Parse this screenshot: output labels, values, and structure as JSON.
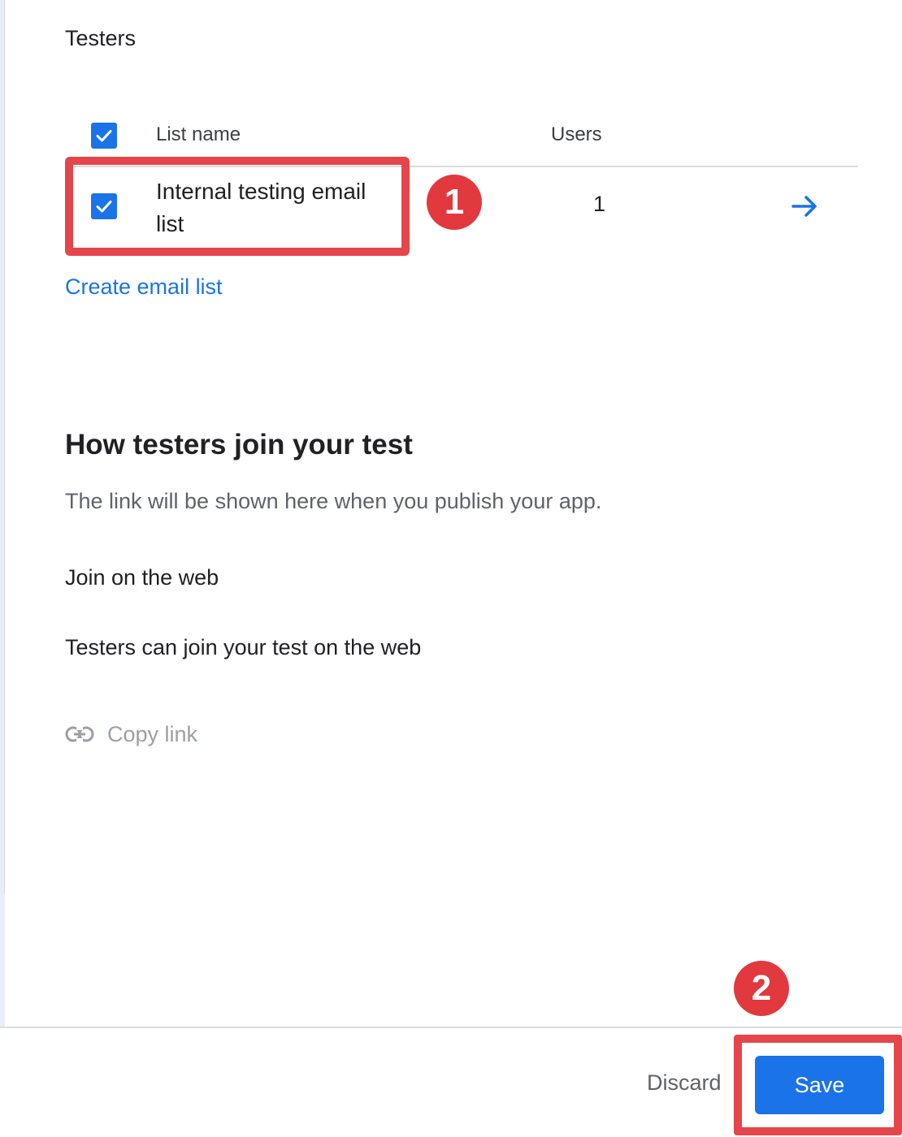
{
  "section": {
    "title": "Testers"
  },
  "table": {
    "header": {
      "list_name": "List name",
      "users": "Users",
      "select_all_checked": true
    },
    "rows": [
      {
        "name": "Internal testing email list",
        "users": "1",
        "checked": true,
        "action_icon": "arrow-right-icon"
      }
    ]
  },
  "create_link": "Create email list",
  "join": {
    "heading": "How testers join your test",
    "description": "The link will be shown here when you publish your app.",
    "web_label": "Join on the web",
    "web_description": "Testers can join your test on the web",
    "copy_link_label": "Copy link",
    "copy_link_icon": "link-icon"
  },
  "footer": {
    "discard_label": "Discard",
    "save_label": "Save"
  },
  "annotations": {
    "badge_1": "1",
    "badge_2": "2",
    "color": "#e4464b"
  },
  "colors": {
    "accent": "#1a73e8",
    "annotation": "#e1393e",
    "muted_text": "#5f6368",
    "disabled_text": "#9aa0a6"
  }
}
